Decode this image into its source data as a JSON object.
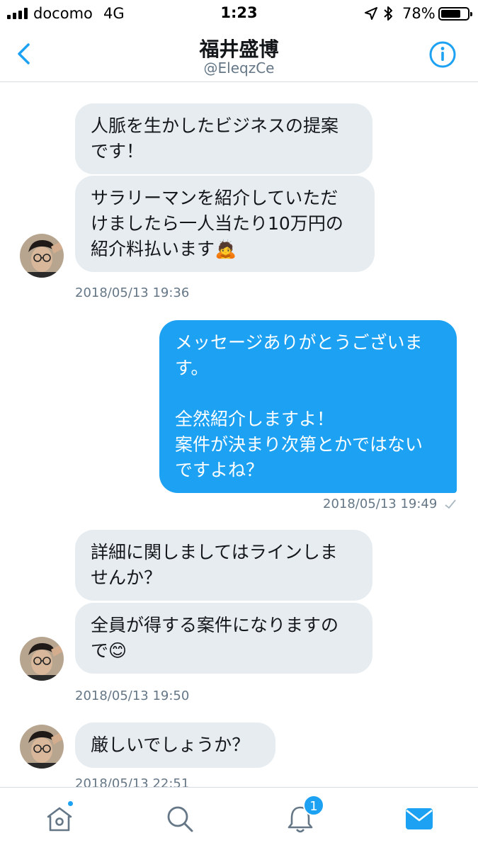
{
  "status_bar": {
    "carrier": "docomo",
    "network": "4G",
    "time": "1:23",
    "battery_percent": "78%",
    "battery_level": 0.78
  },
  "header": {
    "title": "福井盛博",
    "handle": "@EleqzCe",
    "back_icon": "chevron-left-icon",
    "info_icon": "info-icon"
  },
  "messages": [
    {
      "direction": "incoming",
      "text": "人脈を生かしたビジネスの提案\nです！"
    },
    {
      "direction": "incoming",
      "text": "サラリーマンを紹介していただ\nけましたら一人当たり10万円の\n紹介料払います🙇"
    },
    {
      "timestamp": "2018/05/13 19:36"
    },
    {
      "direction": "outgoing",
      "text": "メッセージありがとうございま\nす。\n\n全然紹介しますよ！\n案件が決まり次第とかではない\nですよね？"
    },
    {
      "timestamp": "2018/05/13 19:49",
      "read_icon": "checkmark-icon"
    },
    {
      "direction": "incoming",
      "text": "詳細に関しましてはラインしま\nせんか？"
    },
    {
      "direction": "incoming",
      "text": "全員が得する案件になりますの\nで😊"
    },
    {
      "timestamp": "2018/05/13 19:50"
    },
    {
      "direction": "incoming",
      "text": "厳しいでしょうか？"
    },
    {
      "timestamp": "2018/05/13 22:51"
    }
  ],
  "tabbar": {
    "items": [
      {
        "icon": "home-icon",
        "has_dot": true
      },
      {
        "icon": "search-icon"
      },
      {
        "icon": "bell-icon",
        "badge": "1"
      },
      {
        "icon": "mail-icon",
        "active": true
      }
    ]
  },
  "colors": {
    "accent": "#1da1f2",
    "incoming_bubble": "#e6ecf0",
    "muted_text": "#657786"
  }
}
